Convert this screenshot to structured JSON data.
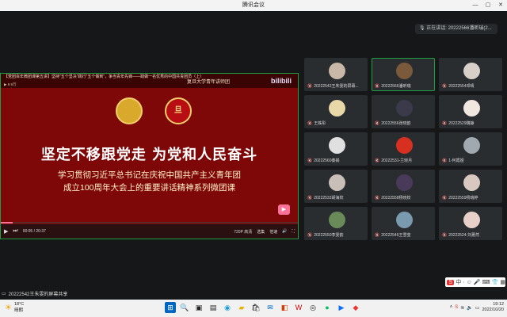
{
  "window": {
    "title": "腾讯会议"
  },
  "speaking": {
    "text": "正在讲话: 20222566潘昕瑞(2..."
  },
  "share": {
    "top_line1": "【党团百年微团课第五讲】坚持\"五个坚决\"践行\"五个做到\"，争当青年先锋——践做一名优秀的中国共青团员（上）",
    "top_line2": "▶ 9.9万",
    "univ": "复旦大学青年讲师团",
    "bili": "bilibili",
    "emblem_text": "旦",
    "slogan": "坚定不移跟党走  为党和人民奋斗",
    "sub1": "学习贯彻习近平总书记在庆祝中国共产主义青年团",
    "sub2": "成立100周年大会上的重要讲话精神系列微团课",
    "time": "00:05 / 20:37",
    "quality": "720P 高清",
    "ctrl_items": [
      "选集",
      "倍速"
    ],
    "progress": 0.04,
    "badge": "▶"
  },
  "share_label": "20222542王朱雯的屏幕共享",
  "participants": [
    {
      "name": "20222542王朱雯的屏幕...",
      "color": "#c9b8a8",
      "active": false
    },
    {
      "name": "20222566潘昕瑞",
      "color": "#7a5a3a",
      "active": true
    },
    {
      "name": "20222554邓晴",
      "color": "#d8d0c8",
      "active": false
    },
    {
      "name": "王姝彤",
      "color": "#e8d8a8",
      "active": false
    },
    {
      "name": "20222556张晓韵",
      "color": "#3a3a4a",
      "active": false
    },
    {
      "name": "20222529魏静",
      "color": "#f0e8e0",
      "active": false
    },
    {
      "name": "20222560秦娟",
      "color": "#e0e0e0",
      "active": false
    },
    {
      "name": "20222531-兰晓月",
      "color": "#d83020",
      "active": false
    },
    {
      "name": "1-何霞娅",
      "color": "#a0a8b0",
      "active": false
    },
    {
      "name": "20222533胡海姣",
      "color": "#c8c0b8",
      "active": false
    },
    {
      "name": "20222558杨晓姣",
      "color": "#4a3a5a",
      "active": false
    },
    {
      "name": "20222559杨瑞婷",
      "color": "#d8c8c0",
      "active": false
    },
    {
      "name": "20222550李雯韵",
      "color": "#6a8a5a",
      "active": false
    },
    {
      "name": "20222546王雪莹",
      "color": "#7a9ab0",
      "active": false
    },
    {
      "name": "20222524-刘蕙然",
      "color": "#e8d0c8",
      "active": false
    }
  ],
  "ime": {
    "label": "中"
  },
  "taskbar": {
    "temp": "18°C",
    "weather": "晴朗",
    "time": "19:12",
    "date": "2022/10/20"
  }
}
